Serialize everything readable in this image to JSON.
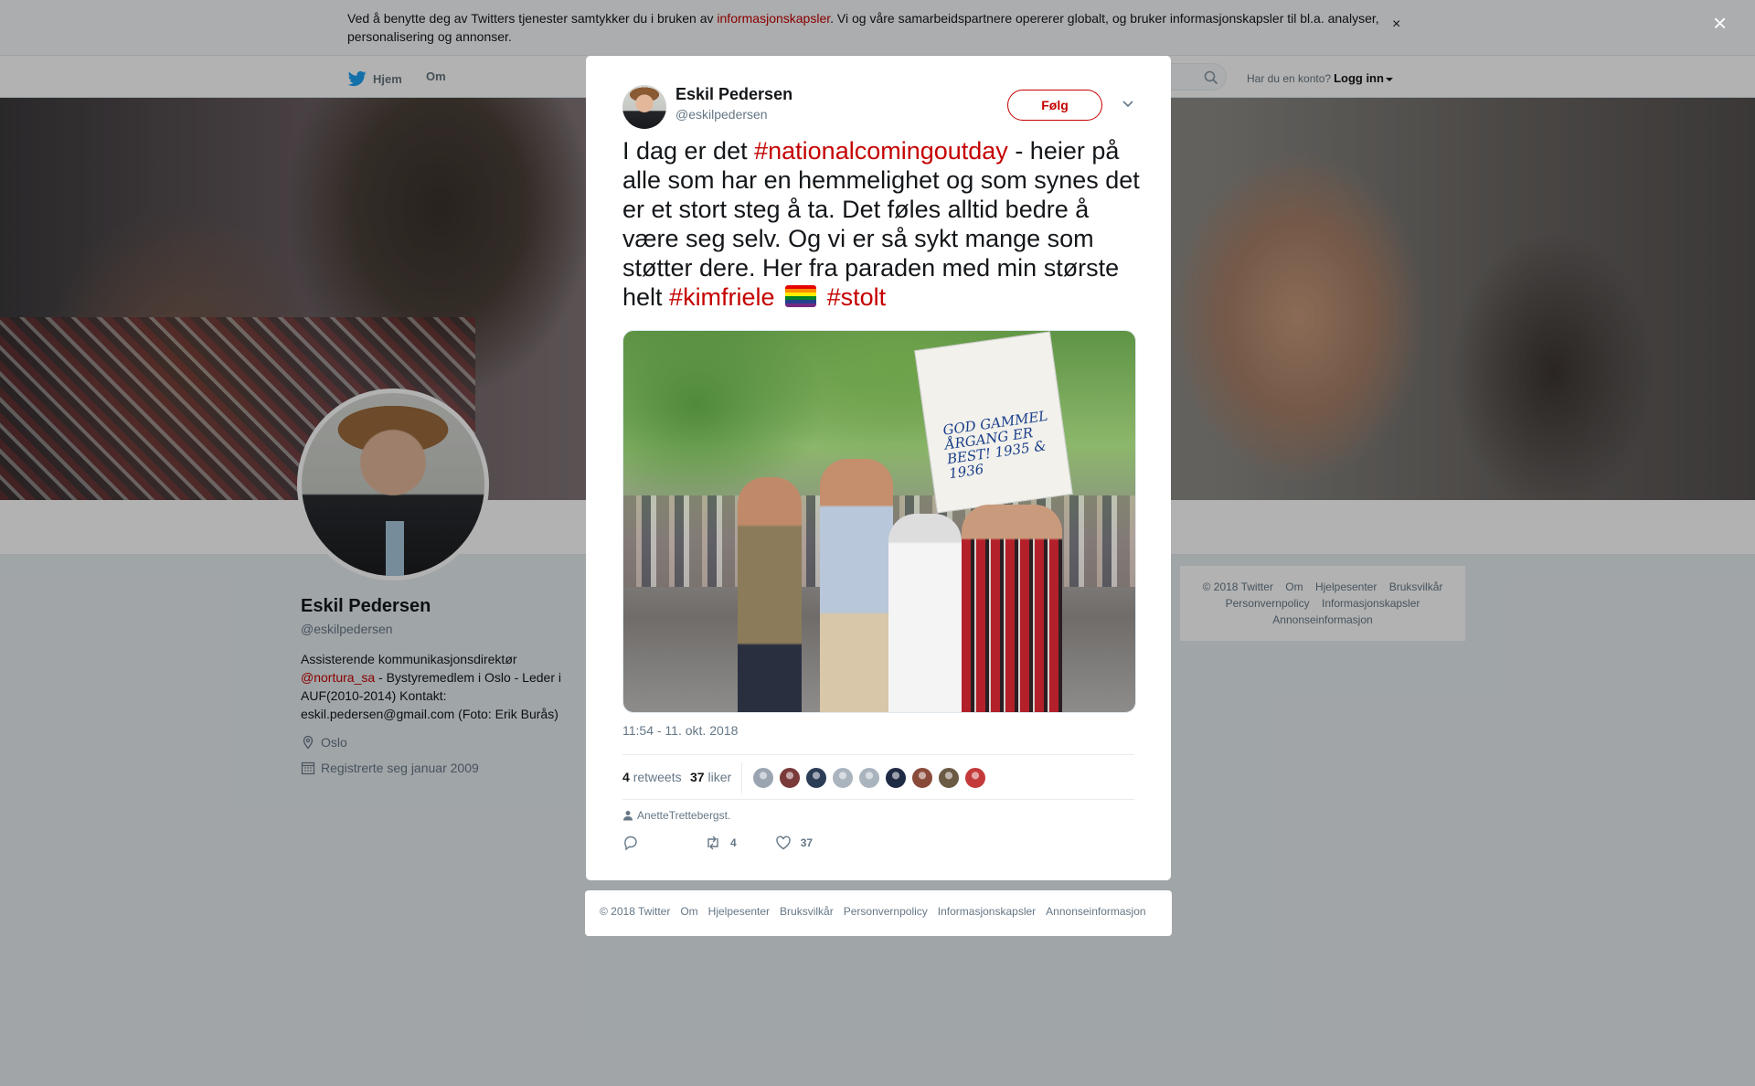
{
  "cookie_banner": {
    "text_before": "Ved å benytte deg av Twitters tjenester samtykker du i bruken av ",
    "link": "informasjonskapsler",
    "text_after": ". Vi og våre samarbeidspartnere opererer globalt, og bruker informasjonskapsler til bl.a. analyser, personalisering og annonser.",
    "close": "×"
  },
  "topnav": {
    "home": "Hjem",
    "about": "Om",
    "login_prompt": "Har du en konto?",
    "login": "Logg inn"
  },
  "profile": {
    "name": "Eskil Pedersen",
    "handle": "@eskilpedersen",
    "bio_line1": "Assisterende kommunikasjonsdirektør",
    "bio_mention": "@nortura_sa",
    "bio_rest": " - Bystyremedlem i Oslo - Leder i AUF(2010-2014) Kontakt: eskil.pedersen@gmail.com (Foto: Erik Burås)",
    "location": "Oslo",
    "joined": "Registrerte seg januar 2009"
  },
  "side_footer": {
    "items": [
      "© 2018 Twitter",
      "Om",
      "Hjelpesenter",
      "Bruksvilkår",
      "Personvernpolicy",
      "Informasjonskapsler",
      "Annonseinformasjon"
    ]
  },
  "overlay": {
    "close": "×"
  },
  "tweet": {
    "author_name": "Eskil Pedersen",
    "author_handle": "@eskilpedersen",
    "follow_label": "Følg",
    "text_1": "I dag er det ",
    "hashtag_1": "#nationalcomingoutday",
    "text_2": " - heier på alle som har en hemmelighet og som synes det er et stort steg å ta. Det føles alltid bedre å være seg selv. Og vi er så sykt mange som støtter dere. Her fra paraden med min største helt ",
    "hashtag_2": "#kimfriele",
    "hashtag_3": "#stolt",
    "media_sign_text": "GOD GAMMEL ÅRGANG ER BEST! 1935 & 1936",
    "timestamp": "11:54 - 11. okt. 2018",
    "retweets_count": "4",
    "retweets_label": "retweets",
    "likes_count": "37",
    "likes_label": "liker",
    "liker_colors": [
      "#9aa5b1",
      "#7a3a3a",
      "#2c3e57",
      "#a9b4bf",
      "#a9b4bf",
      "#1f2a44",
      "#8a4a3a",
      "#6b5a44",
      "#c43a3a"
    ],
    "context_user": "AnetteTrettebergst.",
    "reply_count": "",
    "retweet_count": "4",
    "like_count": "37"
  },
  "modal_footer": {
    "items": [
      "© 2018 Twitter",
      "Om",
      "Hjelpesenter",
      "Bruksvilkår",
      "Personvernpolicy",
      "Informasjonskapsler",
      "Annonseinformasjon"
    ]
  },
  "colors": {
    "accent": "#c50000",
    "secondary_text": "#657786",
    "twitter_blue": "#1da1f2"
  }
}
